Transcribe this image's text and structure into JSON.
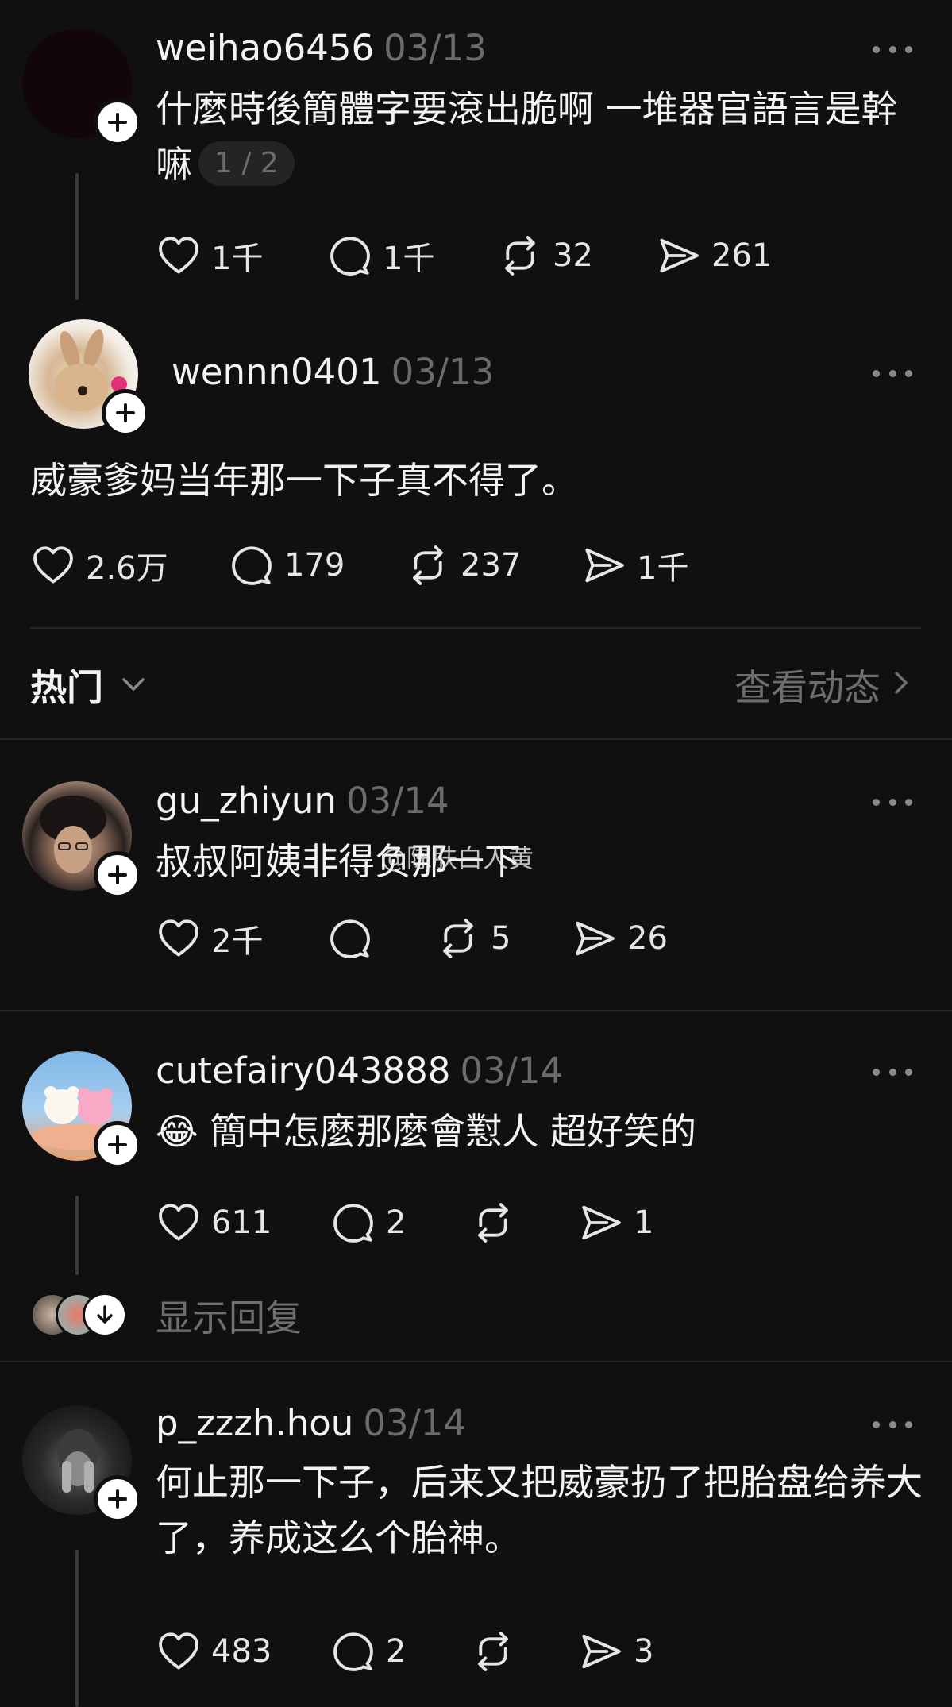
{
  "posts": [
    {
      "username": "weihao6456",
      "date": "03/13",
      "text": "什麼時後簡體字要滾出脆啊  一堆器官語言是幹嘛",
      "page_badge": "1 / 2",
      "likes": "1千",
      "comments": "1千",
      "reposts": "32",
      "shares": "261"
    },
    {
      "username": "wennn0401",
      "date": "03/13",
      "text": "威豪爹妈当年那一下子真不得了。",
      "likes": "2.6万",
      "comments": "179",
      "reposts": "237",
      "shares": "1千"
    },
    {
      "username": "gu_zhiyun",
      "date": "03/14",
      "text": "叔叔阿姨非得负那一下",
      "likes": "2千",
      "comments": "",
      "reposts": "5",
      "shares": "26"
    },
    {
      "username": "cutefairy043888",
      "date": "03/14",
      "text": "😂 簡中怎麼那麼會懟人 超好笑的",
      "likes": "611",
      "comments": "2",
      "reposts": "",
      "shares": "1"
    },
    {
      "username": "p_zzzh.hou",
      "date": "03/14",
      "text": "何止那一下子，后来又把威豪扔了把胎盘给养大了，养成这么个胎神。",
      "likes": "483",
      "comments": "2",
      "reposts": "",
      "shares": "3"
    }
  ],
  "sort": {
    "label": "热门",
    "view_activity": "查看动态"
  },
  "show_replies": "显示回复",
  "watermark": "@陈肤白人黄",
  "colors": {
    "background": "#101010",
    "text": "#f3f3f3",
    "muted": "#6b6b6b",
    "divider": "#262626"
  },
  "icons": {
    "like": "heart-icon",
    "comment": "speech-bubble-icon",
    "repost": "repost-arrows-icon",
    "share": "send-arrow-icon",
    "more": "more-dots-icon",
    "follow": "plus-icon"
  }
}
